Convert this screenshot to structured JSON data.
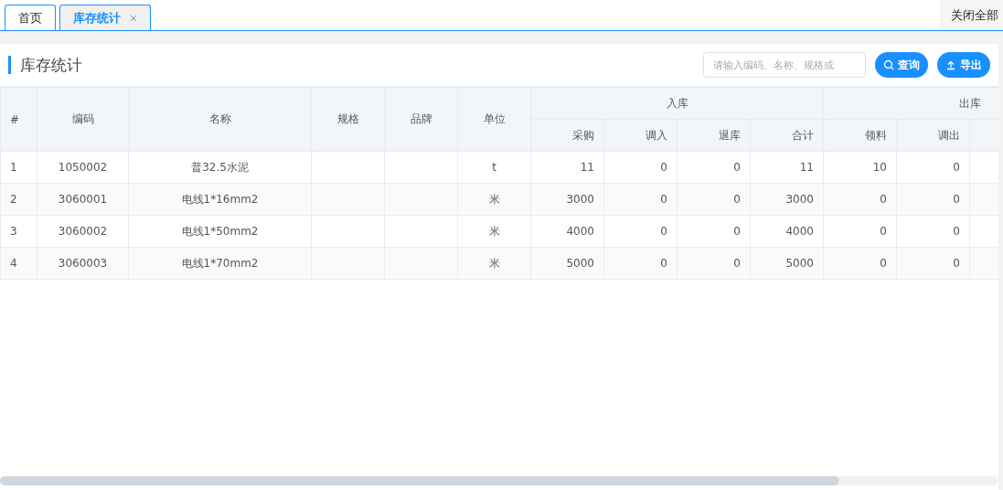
{
  "tabs": [
    {
      "label": "首页",
      "selected": false
    },
    {
      "label": "库存统计",
      "selected": true
    }
  ],
  "close_all": "关闭全部",
  "panel": {
    "title": "库存统计",
    "search": {
      "placeholder": "请输入编码、名称、规格或"
    },
    "buttons": [
      {
        "kind": "search",
        "label": "查询"
      },
      {
        "kind": "export",
        "label": "导出"
      }
    ]
  },
  "table": {
    "columns": [
      "#",
      "编码",
      "名称",
      "规格",
      "品牌",
      "单位"
    ],
    "groups": [
      {
        "label": "入库",
        "columns": [
          "采购",
          "调入",
          "退库",
          "合计"
        ]
      },
      {
        "label": "出库",
        "columns": [
          "领料",
          "调出"
        ]
      }
    ],
    "rows": [
      [
        "1",
        "1050002",
        "普32.5水泥",
        "",
        "",
        "t",
        "11",
        "0",
        "0",
        "11",
        "10",
        "0"
      ],
      [
        "2",
        "3060001",
        "电线1*16mm2",
        "",
        "",
        "米",
        "3000",
        "0",
        "0",
        "3000",
        "0",
        "0"
      ],
      [
        "3",
        "3060002",
        "电线1*50mm2",
        "",
        "",
        "米",
        "4000",
        "0",
        "0",
        "4000",
        "0",
        "0"
      ],
      [
        "4",
        "3060003",
        "电线1*70mm2",
        "",
        "",
        "米",
        "5000",
        "0",
        "0",
        "5000",
        "0",
        "0"
      ]
    ]
  }
}
